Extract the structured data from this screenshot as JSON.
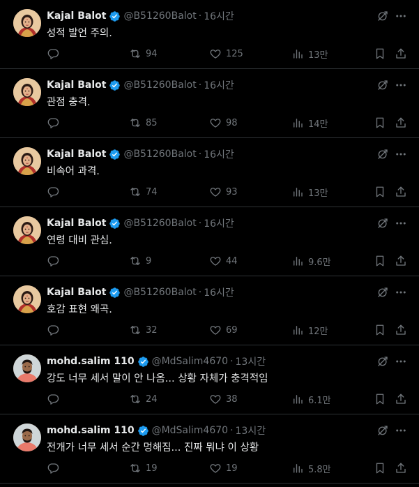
{
  "tweets": [
    {
      "avatar": "woman-avatar",
      "name": "Kajal Balot",
      "handle": "@B51260Balot",
      "separator": "·",
      "time": "16시간",
      "text": "성적 발언 주의.",
      "replies": "",
      "retweets": "94",
      "likes": "125",
      "views": "13만"
    },
    {
      "avatar": "woman-avatar",
      "name": "Kajal Balot",
      "handle": "@B51260Balot",
      "separator": "·",
      "time": "16시간",
      "text": "관점 충격.",
      "replies": "",
      "retweets": "85",
      "likes": "98",
      "views": "14만"
    },
    {
      "avatar": "woman-avatar",
      "name": "Kajal Balot",
      "handle": "@B51260Balot",
      "separator": "·",
      "time": "16시간",
      "text": "비속어 과격.",
      "replies": "",
      "retweets": "74",
      "likes": "93",
      "views": "13만"
    },
    {
      "avatar": "woman-avatar",
      "name": "Kajal Balot",
      "handle": "@B51260Balot",
      "separator": "·",
      "time": "16시간",
      "text": "연령 대비 관심.",
      "replies": "",
      "retweets": "9",
      "likes": "44",
      "views": "9.6만"
    },
    {
      "avatar": "woman-avatar",
      "name": "Kajal Balot",
      "handle": "@B51260Balot",
      "separator": "·",
      "time": "16시간",
      "text": "호감 표현 왜곡.",
      "replies": "",
      "retweets": "32",
      "likes": "69",
      "views": "12만"
    },
    {
      "avatar": "man-avatar",
      "name": "mohd.salim 110",
      "handle": "@MdSalim4670",
      "separator": "·",
      "time": "13시간",
      "text": "강도 너무 세서 말이 안 나옴... 상황 자체가 충격적임",
      "replies": "",
      "retweets": "24",
      "likes": "38",
      "views": "6.1만"
    },
    {
      "avatar": "man-avatar",
      "name": "mohd.salim 110",
      "handle": "@MdSalim4670",
      "separator": "·",
      "time": "13시간",
      "text": "전개가 너무 세서 순간 멍해짐... 진짜 뭐냐 이 상황",
      "replies": "",
      "retweets": "19",
      "likes": "19",
      "views": "5.8만"
    }
  ],
  "colors": {
    "background": "#000000",
    "primary_text": "#e7e9ea",
    "secondary_text": "#71767b",
    "divider": "#2f3336",
    "verified": "#1d9bf0"
  },
  "icons": [
    "verified-badge-icon",
    "grok-icon",
    "more-icon",
    "reply-icon",
    "retweet-icon",
    "like-icon",
    "views-icon",
    "bookmark-icon",
    "share-icon"
  ]
}
